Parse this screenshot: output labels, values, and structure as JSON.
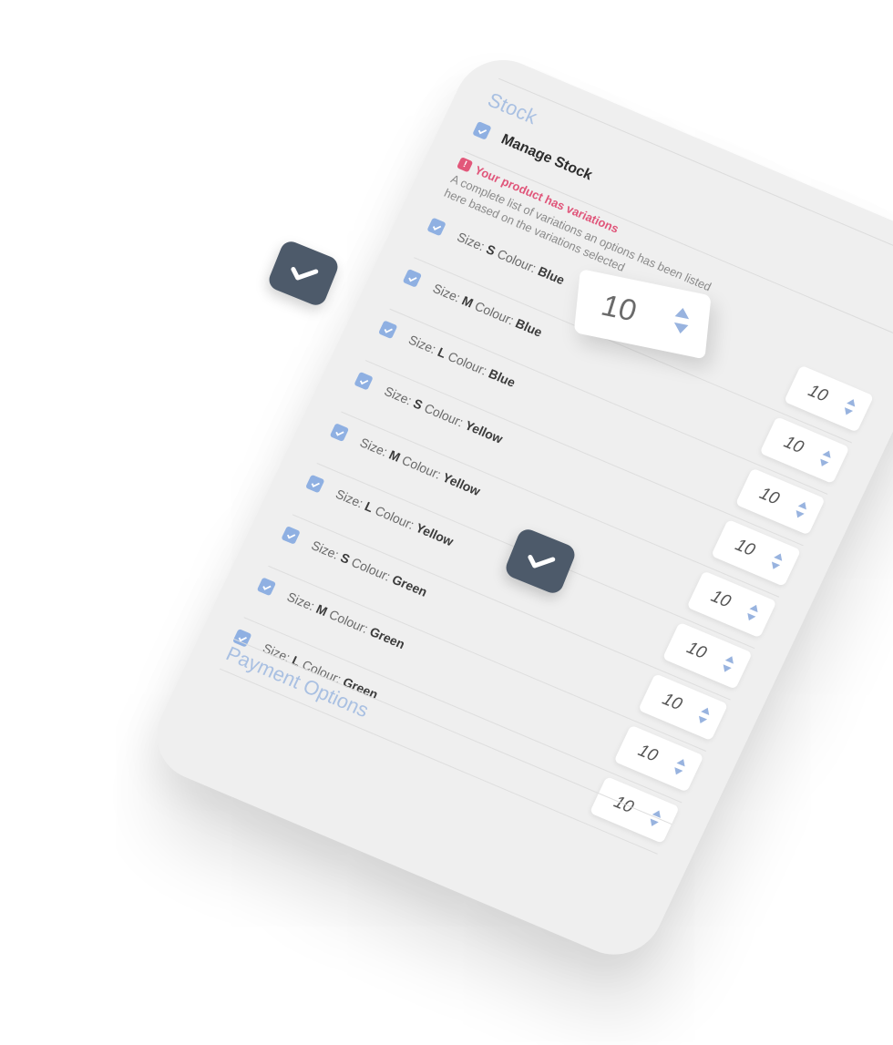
{
  "stock": {
    "title": "Stock",
    "manage_label": "Manage Stock",
    "warning": "Your product has variations",
    "description": "A complete list of variations an options has been listed here based on the variations selected"
  },
  "variants": [
    {
      "size_label": "Size:",
      "size": "S",
      "colour_label": "Colour:",
      "colour": "Blue",
      "qty": "10"
    },
    {
      "size_label": "Size:",
      "size": "M",
      "colour_label": "Colour:",
      "colour": "Blue",
      "qty": "10"
    },
    {
      "size_label": "Size:",
      "size": "L",
      "colour_label": "Colour:",
      "colour": "Blue",
      "qty": "10"
    },
    {
      "size_label": "Size:",
      "size": "S",
      "colour_label": "Colour:",
      "colour": "Yellow",
      "qty": "10"
    },
    {
      "size_label": "Size:",
      "size": "M",
      "colour_label": "Colour:",
      "colour": "Yellow",
      "qty": "10"
    },
    {
      "size_label": "Size:",
      "size": "L",
      "colour_label": "Colour:",
      "colour": "Yellow",
      "qty": "10"
    },
    {
      "size_label": "Size:",
      "size": "S",
      "colour_label": "Colour:",
      "colour": "Green",
      "qty": "10"
    },
    {
      "size_label": "Size:",
      "size": "M",
      "colour_label": "Colour:",
      "colour": "Green",
      "qty": "10"
    },
    {
      "size_label": "Size:",
      "size": "L",
      "colour_label": "Colour:",
      "colour": "Green",
      "qty": "10"
    }
  ],
  "payment": {
    "title": "Payment Options"
  },
  "zoomed_stepper": {
    "value": "10"
  },
  "colors": {
    "accent": "#8fb0e2",
    "heading": "#a9c0e2",
    "warning": "#e0557a",
    "badge": "#4d5a6a"
  },
  "icons": [
    "check-icon",
    "warning-icon",
    "arrow-up-icon",
    "arrow-down-icon"
  ]
}
